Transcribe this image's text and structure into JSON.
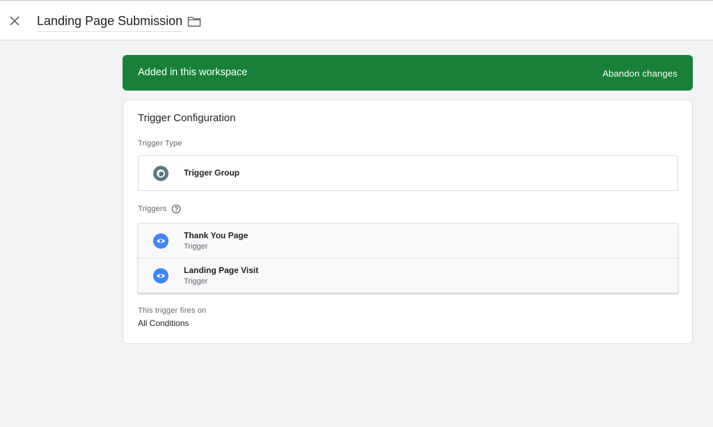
{
  "header": {
    "title": "Landing Page Submission",
    "close_icon": "close-icon",
    "folder_icon": "folder-icon"
  },
  "banner": {
    "text": "Added in this workspace",
    "action": "Abandon changes",
    "color": "#188038"
  },
  "config": {
    "title": "Trigger Configuration",
    "type_label": "Trigger Type",
    "type": {
      "name": "Trigger Group",
      "icon": "trigger-group-icon",
      "icon_color": "#5f7a84"
    },
    "triggers_label": "Triggers",
    "help_icon": "help-icon",
    "triggers": [
      {
        "name": "Thank You Page",
        "sub": "Trigger",
        "icon": "eye-icon",
        "icon_color": "#4285f4"
      },
      {
        "name": "Landing Page Visit",
        "sub": "Trigger",
        "icon": "eye-icon",
        "icon_color": "#4285f4"
      }
    ],
    "fires_label": "This trigger fires on",
    "fires_value": "All Conditions"
  }
}
